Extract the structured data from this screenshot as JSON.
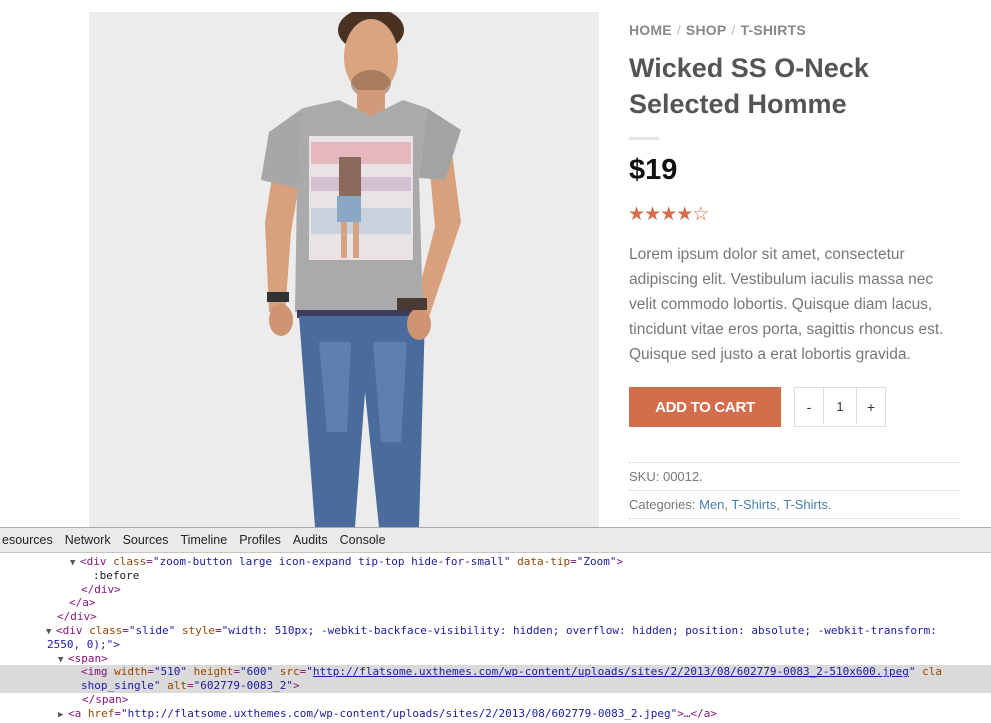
{
  "breadcrumb": {
    "items": [
      "HOME",
      "SHOP",
      "T-SHIRTS"
    ],
    "separator": "/"
  },
  "product": {
    "title": "Wicked SS O-Neck Selected Homme",
    "price": "$19",
    "rating": 4,
    "rating_max": 5,
    "description": "Lorem ipsum dolor sit amet, consectetur adipiscing elit. Vestibulum iaculis massa nec velit commodo lobortis. Quisque diam lacus, tincidunt vitae eros porta, sagittis rhoncus est. Quisque sed justo a erat lobortis gravida.",
    "add_to_cart_label": "ADD TO CART",
    "qty_minus": "-",
    "qty_value": "1",
    "qty_plus": "+",
    "sku_label": "SKU:",
    "sku_value": "00012.",
    "categories_label": "Categories:",
    "categories": [
      "Men",
      "T-Shirts",
      "T-Shirts"
    ]
  },
  "colors": {
    "accent": "#d26e4b",
    "link": "#4a7fb5"
  },
  "devtools": {
    "tabs": [
      "esources",
      "Network",
      "Sources",
      "Timeline",
      "Profiles",
      "Audits",
      "Console"
    ],
    "code": {
      "l1_tag_open": "<div ",
      "l1_a1": "class",
      "l1_v1": "\"zoom-button large icon-expand tip-top hide-for-small\"",
      "l1_a2": "data-tip",
      "l1_v2": "\"Zoom\"",
      "l1_tag_close": ">",
      "l2": ":before",
      "l3": "</div>",
      "l4": "</a>",
      "l5": "</div>",
      "l6_tag_open": "<div ",
      "l6_a1": "class",
      "l6_v1": "\"slide\"",
      "l6_a2": "style",
      "l6_v2": "\"width: 510px; -webkit-backface-visibility: hidden; overflow: hidden; position: absolute; -webkit-transform:",
      "l7": "2550, 0);\">",
      "l8": "<span>",
      "l9_tag_open": "<img ",
      "l9_a1": "width",
      "l9_v1": "\"510\"",
      "l9_a2": "height",
      "l9_v2": "\"600\"",
      "l9_a3": "src",
      "l9_url": "http://flatsome.uxthemes.com/wp-content/uploads/sites/2/2013/08/602779-0083_2-510x600.jpeg",
      "l9_a4": "cla",
      "l10_v": "shop_single\"",
      "l10_a": "alt",
      "l10_v2": "\"602779-0083_2\"",
      "l10_close": ">",
      "l11": "</span>",
      "l12_tag_open": "<a ",
      "l12_a": "href",
      "l12_v": "\"http://flatsome.uxthemes.com/wp-content/uploads/sites/2/2013/08/602779-0083_2.jpeg\"",
      "l12_rest": ">…</a>"
    }
  }
}
